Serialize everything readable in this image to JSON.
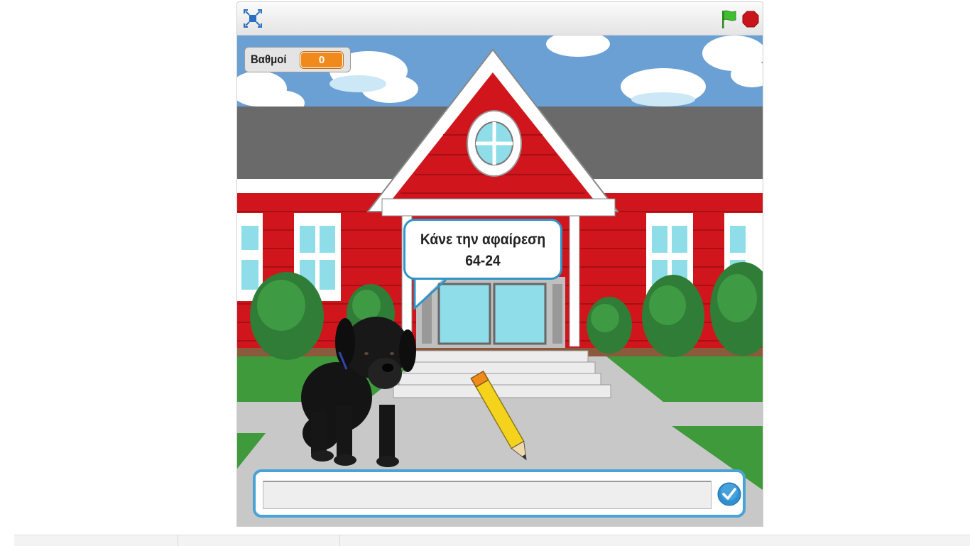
{
  "controls": {
    "fullscreen_icon": "fullscreen-toggle-icon",
    "green_flag_icon": "green-flag-icon",
    "stop_icon": "stop-sign-icon",
    "flag_color": "#3fbf2f",
    "stop_color": "#c8141a"
  },
  "monitor": {
    "label": "Βαθμοί",
    "value": "0",
    "value_color": "#f08a1c"
  },
  "speech": {
    "line1": "Κάνε την αφαίρεση",
    "line2": "64-24"
  },
  "ask": {
    "answer_value": "",
    "submit_icon": "check-mark-icon",
    "accent": "#4aa3d6"
  },
  "sprites": [
    "school-backdrop",
    "black-puppy-sprite",
    "pencil-sprite"
  ]
}
